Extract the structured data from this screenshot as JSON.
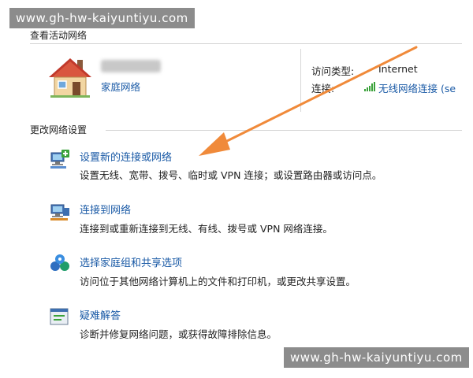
{
  "watermark": {
    "top": "www.gh-hw-kaiyuntiyu.com",
    "bottom": "www.gh-hw-kaiyuntiyu.com"
  },
  "active_networks": {
    "section_title": "查看活动网络",
    "network_type": "家庭网络",
    "access_type_label": "访问类型:",
    "access_type_value": "Internet",
    "connection_label": "连接:",
    "connection_value": "无线网络连接 (se"
  },
  "change_settings": {
    "section_title": "更改网络设置",
    "tasks": [
      {
        "icon": "new-connection-icon",
        "title": "设置新的连接或网络",
        "desc": "设置无线、宽带、拨号、临时或 VPN 连接；或设置路由器或访问点。"
      },
      {
        "icon": "connect-network-icon",
        "title": "连接到网络",
        "desc": "连接到或重新连接到无线、有线、拨号或 VPN 网络连接。"
      },
      {
        "icon": "homegroup-icon",
        "title": "选择家庭组和共享选项",
        "desc": "访问位于其他网络计算机上的文件和打印机，或更改共享设置。"
      },
      {
        "icon": "troubleshoot-icon",
        "title": "疑难解答",
        "desc": "诊断并修复网络问题，或获得故障排除信息。"
      }
    ]
  },
  "colors": {
    "link": "#1a5aa6",
    "arrow": "#f08a3a"
  }
}
